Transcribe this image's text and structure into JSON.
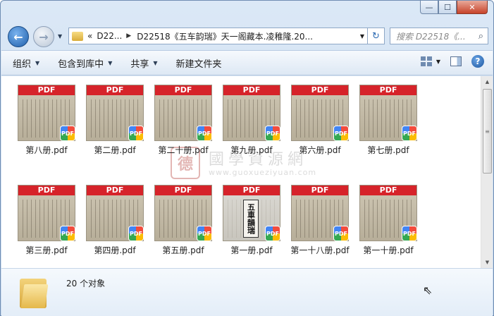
{
  "window": {
    "caption_buttons": {
      "minimize": "—",
      "maximize": "☐",
      "close": "✕"
    }
  },
  "nav": {
    "back_glyph": "←",
    "forward_glyph": "→",
    "address": {
      "prefix": "«",
      "crumb1": "D22...",
      "crumb2": "D22518《五车韵瑞》天一阁藏本.凌稚隆.20..."
    },
    "search_placeholder": "搜索 D22518《...",
    "search_glyph": "⌕",
    "refresh_glyph": "↻"
  },
  "toolbar": {
    "organize": "组织",
    "include_library": "包含到库中",
    "share": "共享",
    "new_folder": "新建文件夹",
    "help": "?"
  },
  "files": [
    {
      "label": "第八册.pdf",
      "thumb": "page",
      "band": "PDF",
      "badge": "PDF"
    },
    {
      "label": "第二册.pdf",
      "thumb": "page",
      "band": "PDF",
      "badge": "PDF"
    },
    {
      "label": "第二十册.pdf",
      "thumb": "page",
      "band": "PDF",
      "badge": "PDF"
    },
    {
      "label": "第九册.pdf",
      "thumb": "page",
      "band": "PDF",
      "badge": "PDF"
    },
    {
      "label": "第六册.pdf",
      "thumb": "page",
      "band": "PDF",
      "badge": "PDF"
    },
    {
      "label": "第七册.pdf",
      "thumb": "page",
      "band": "PDF",
      "badge": "PDF"
    },
    {
      "label": "第三册.pdf",
      "thumb": "page",
      "band": "PDF",
      "badge": "PDF"
    },
    {
      "label": "第四册.pdf",
      "thumb": "page",
      "band": "PDF",
      "badge": "PDF"
    },
    {
      "label": "第五册.pdf",
      "thumb": "page",
      "band": "PDF",
      "badge": "PDF"
    },
    {
      "label": "第一册.pdf",
      "thumb": "cover",
      "band": "PDF",
      "badge": "PDF",
      "cover_title": "五車韻瑞"
    },
    {
      "label": "第一十八册.pdf",
      "thumb": "page",
      "band": "PDF",
      "badge": "PDF"
    },
    {
      "label": "第一十册.pdf",
      "thumb": "page",
      "band": "PDF",
      "badge": "PDF"
    }
  ],
  "watermark": {
    "seal": "德",
    "chinese": "國學資源網",
    "url": "www.guoxueziyuan.com"
  },
  "status": {
    "count": "20 个对象"
  }
}
